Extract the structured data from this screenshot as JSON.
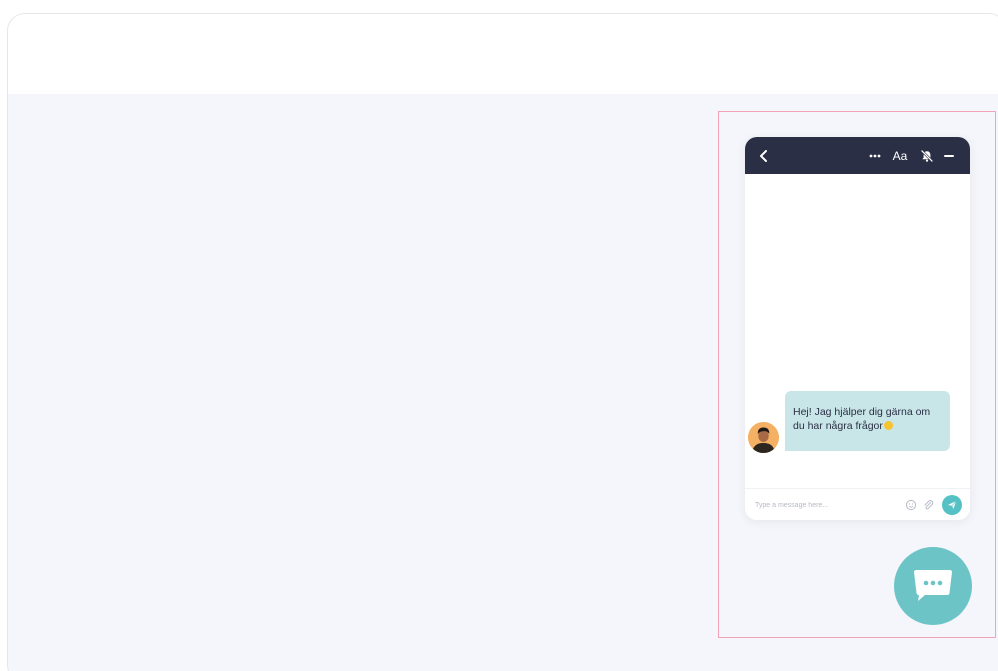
{
  "header": {
    "font_toggle_label": "Aa"
  },
  "message": {
    "text": "Hej! Jag hjälper dig gärna om du har några frågor"
  },
  "composer": {
    "placeholder": "Type a message here..."
  },
  "icons": {
    "back": "chevron-left-icon",
    "more": "more-dots-icon",
    "mute": "bell-off-icon",
    "minimize": "minus-icon",
    "emoji": "smiley-icon",
    "attach": "paperclip-icon",
    "send": "send-icon",
    "launcher": "chat-bubble-icon"
  },
  "colors": {
    "header_bg": "#2b2f45",
    "bubble_bg": "#c8e6e7",
    "accent": "#56c1c4",
    "launcher_bg": "#6cc4c7",
    "highlight_border": "#f4a3b6",
    "page_bg": "#f5f6fb"
  }
}
